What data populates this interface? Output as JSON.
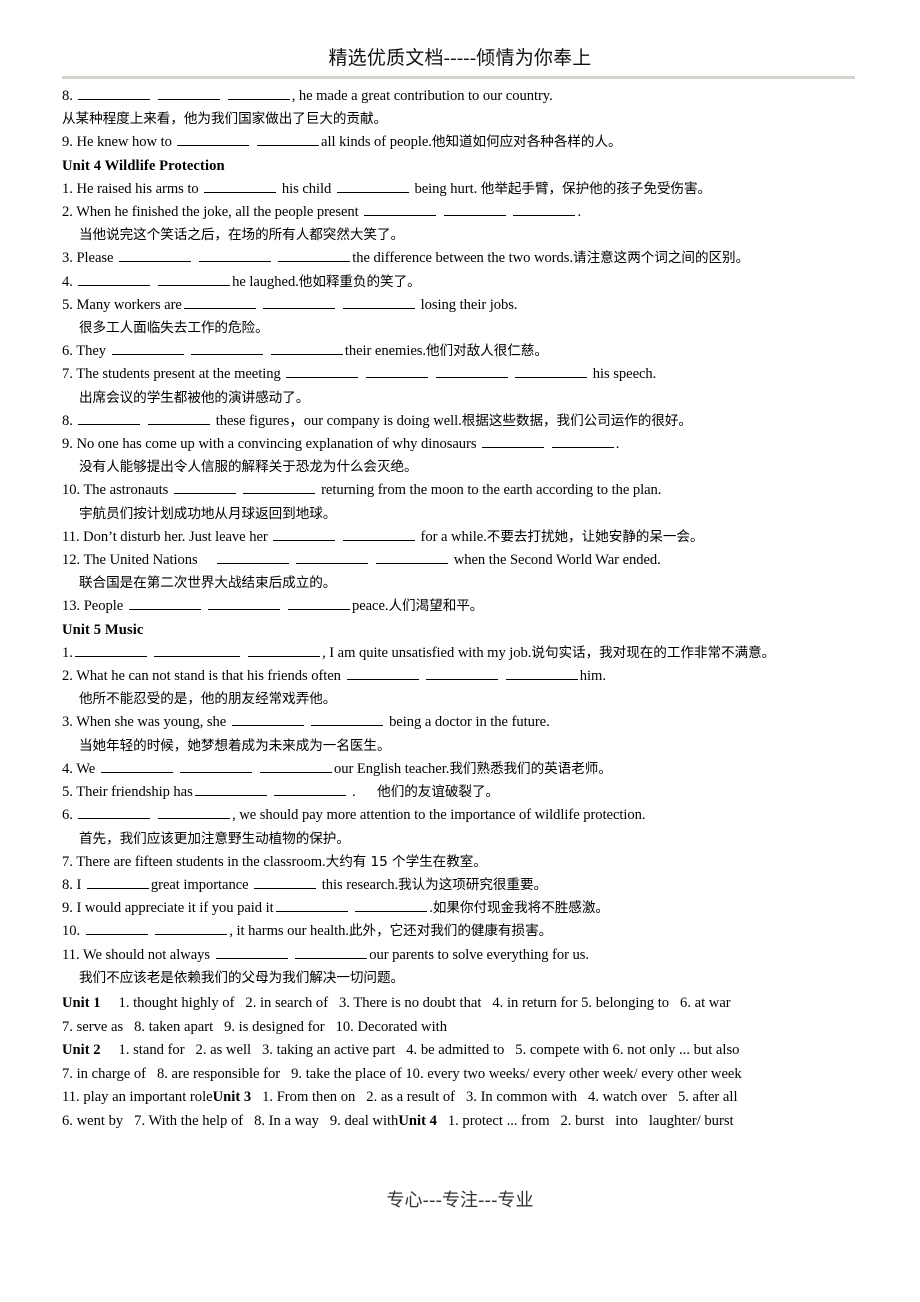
{
  "header": {
    "text": "精选优质文档-----倾情为你奉上",
    "rule_color": "#cfd4cc"
  },
  "footer": {
    "text": "专心---专注---专业"
  },
  "carryover": {
    "item8_en_tail": ", he made a great contribution to our country.",
    "item8_num": "8.",
    "item8_cn": "从某种程度上来看，他为我们国家做出了巨大的贡献。",
    "item9_num": "9.",
    "item9_en_a": "He knew how to",
    "item9_en_b": "all kinds of people.",
    "item9_cn": "他知道如何应对各种各样的人。"
  },
  "unit4": {
    "title": "Unit 4 Wildlife Protection",
    "items": [
      {
        "num": "1.",
        "en_a": "He raised his arms to",
        "en_b": "his child",
        "en_c": "being hurt.",
        "cn": "他举起手臂，保护他的孩子免受伤害。"
      },
      {
        "num": "2.",
        "en_a": "When he finished the joke, all the people present",
        "en_b": ".",
        "cn": "当他说完这个笑话之后，在场的所有人都突然大笑了。"
      },
      {
        "num": "3.",
        "en_a": "Please",
        "en_b": "the difference between the two words.",
        "cn": "请注意这两个词之间的区别。"
      },
      {
        "num": "4.",
        "en_a": "",
        "en_b": "he laughed.",
        "cn": "他如释重负的笑了。"
      },
      {
        "num": "5.",
        "en_a": "Many workers are",
        "en_b": "losing their jobs.",
        "cn": "很多工人面临失去工作的危险。"
      },
      {
        "num": "6.",
        "en_a": "They",
        "en_b": "their enemies.",
        "cn": "他们对敌人很仁慈。"
      },
      {
        "num": "7.",
        "en_a": "The students present at the meeting",
        "en_b": "his speech.",
        "cn": "出席会议的学生都被他的演讲感动了。"
      },
      {
        "num": "8.",
        "en_a": "",
        "en_b": "these figures，our company is doing well.",
        "cn": "根据这些数据，我们公司运作的很好。"
      },
      {
        "num": "9.",
        "en_a": "No one has come up with a convincing explanation of why dinosaurs",
        "en_b": ".",
        "cn": "没有人能够提出令人信服的解释关于恐龙为什么会灭绝。"
      },
      {
        "num": "10.",
        "en_a": "The astronauts",
        "en_b": "returning from the moon to the earth according to the plan.",
        "cn": "宇航员们按计划成功地从月球返回到地球。"
      },
      {
        "num": "11.",
        "en_a": "Don’t disturb her. Just leave her",
        "en_b": "for a while.",
        "cn": "不要去打扰她，让她安静的呆一会。"
      },
      {
        "num": "12.",
        "en_a": "The United Nations",
        "en_b": "when the Second World War ended.",
        "cn": "联合国是在第二次世界大战结束后成立的。"
      },
      {
        "num": "13.",
        "en_a": "People",
        "en_b": "peace.",
        "cn": "人们渴望和平。"
      }
    ]
  },
  "unit5": {
    "title": "Unit 5 Music",
    "items": [
      {
        "num": "1.",
        "en_a": "",
        "en_b": ", I am quite unsatisfied with my job.",
        "cn": "说句实话，我对现在的工作非常不满意。"
      },
      {
        "num": "2.",
        "en_a": "What he can not stand is that his friends often",
        "en_b": "him.",
        "cn": "他所不能忍受的是，他的朋友经常戏弄他。"
      },
      {
        "num": "3.",
        "en_a": "When she was young, she",
        "en_b": "being a doctor in the future.",
        "cn": "当她年轻的时候，她梦想着成为未来成为一名医生。"
      },
      {
        "num": "4.",
        "en_a": "We",
        "en_b": "our English teacher.",
        "cn": "我们熟悉我们的英语老师。"
      },
      {
        "num": "5.",
        "en_a": "Their friendship has",
        "en_b": ".",
        "cn": "他们的友谊破裂了。"
      },
      {
        "num": "6.",
        "en_a": "",
        "en_b": ", we should pay more attention to the importance of wildlife protection.",
        "cn": "首先，我们应该更加注意野生动植物的保护。"
      },
      {
        "num": "7.",
        "en_a": "There are fifteen students in the classroom.",
        "en_b": "",
        "cn": "大约有 15 个学生在教室。"
      },
      {
        "num": "8.",
        "en_a": "I",
        "en_mid": "great importance",
        "en_b": "this research.",
        "cn": "我认为这项研究很重要。"
      },
      {
        "num": "9.",
        "en_a": "I would appreciate it if you paid it",
        "en_b": ".",
        "cn": "如果你付现金我将不胜感激。"
      },
      {
        "num": "10.",
        "en_a": "",
        "en_b": ", it harms our health.",
        "cn": "此外，它还对我们的健康有损害。"
      },
      {
        "num": "11.",
        "en_a": "We should not always",
        "en_b": "our parents to solve everything for us.",
        "cn": "我们不应该老是依赖我们的父母为我们解决一切问题。"
      }
    ]
  },
  "answer_key": {
    "lines": [
      {
        "label": "Unit 1",
        "text": "1. thought highly of   2. in search of   3. There is no doubt that   4. in return for 5. belonging to   6. at war"
      },
      {
        "label": "",
        "text": "7. serve as   8. taken apart   9. is designed for   10. Decorated with"
      },
      {
        "label": "Unit 2",
        "text": "1. stand for   2. as well   3. taking an active part   4. be admitted to   5. compete with 6. not only ... but also"
      },
      {
        "label": "",
        "text": "7. in charge of   8. are responsible for   9. take the place of 10. every two weeks/ every other week/ every other week"
      },
      {
        "label": "",
        "text": "11. play an important roleUnit 3   1. From then on   2. as a result of   3. In common with   4. watch over   5. after all"
      },
      {
        "label": "",
        "text": "6. went by   7. With the help of   8. In a way   9. deal withUnit 4   1. protect ... from   2. burst   into   laughter/ burst"
      }
    ]
  }
}
